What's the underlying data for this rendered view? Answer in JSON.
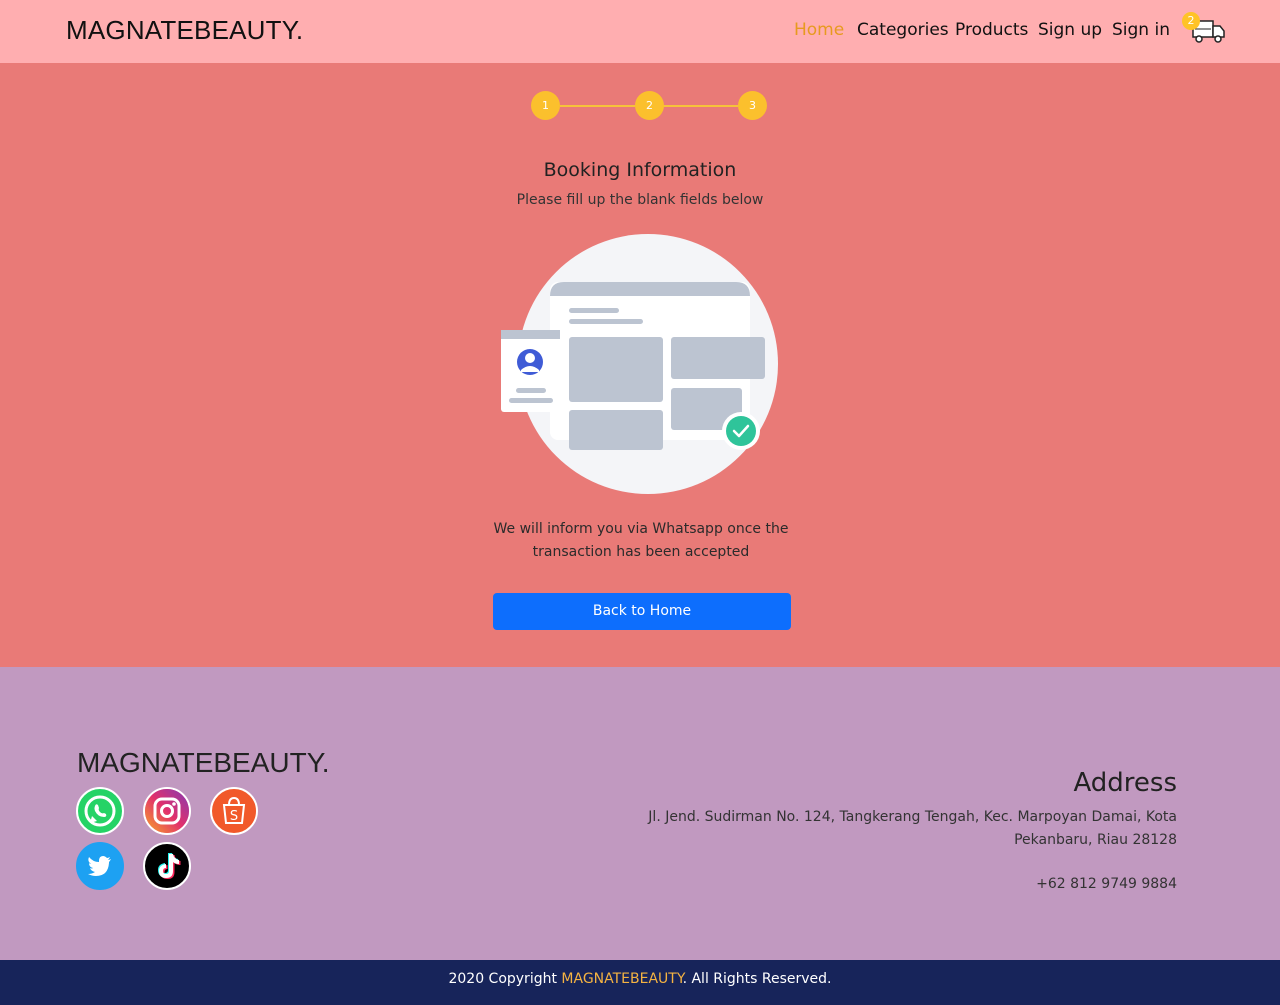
{
  "header": {
    "brand": "MAGNATEBEAUTY.",
    "nav": [
      "Home",
      "Categories",
      "Products",
      "Sign up",
      "Sign in"
    ],
    "cart_count": "2"
  },
  "stepper": {
    "steps": [
      "1",
      "2",
      "3"
    ]
  },
  "main": {
    "title": "Booking Information",
    "subtitle": "Please fill up the blank fields below",
    "info_line1": "We will inform you via Whatsapp once the",
    "info_line2": "transaction has been accepted",
    "button_label": "Back to Home"
  },
  "footer": {
    "brand": "MAGNATEBEAUTY.",
    "social": [
      "whatsapp-icon",
      "instagram-icon",
      "shopee-icon",
      "twitter-icon",
      "tiktok-icon"
    ],
    "address_title": "Address",
    "address_line1": "Jl. Jend. Sudirman No. 124, Tangkerang Tengah, Kec. Marpoyan Damai, Kota",
    "address_line2": "Pekanbaru, Riau 28128",
    "phone": "+62 812 9749 9884"
  },
  "copyright": {
    "prefix": "2020 Copyright ",
    "brand": "MAGNATEBEAUTY",
    "suffix": ". All Rights Reserved."
  },
  "colors": {
    "header_bg": "#ffaeb0",
    "main_bg": "#e97a77",
    "footer_bg": "#c199c0",
    "copyright_bg": "#17245a",
    "accent": "#e79a1f",
    "button": "#0d6efd",
    "step": "#fbc02d"
  }
}
